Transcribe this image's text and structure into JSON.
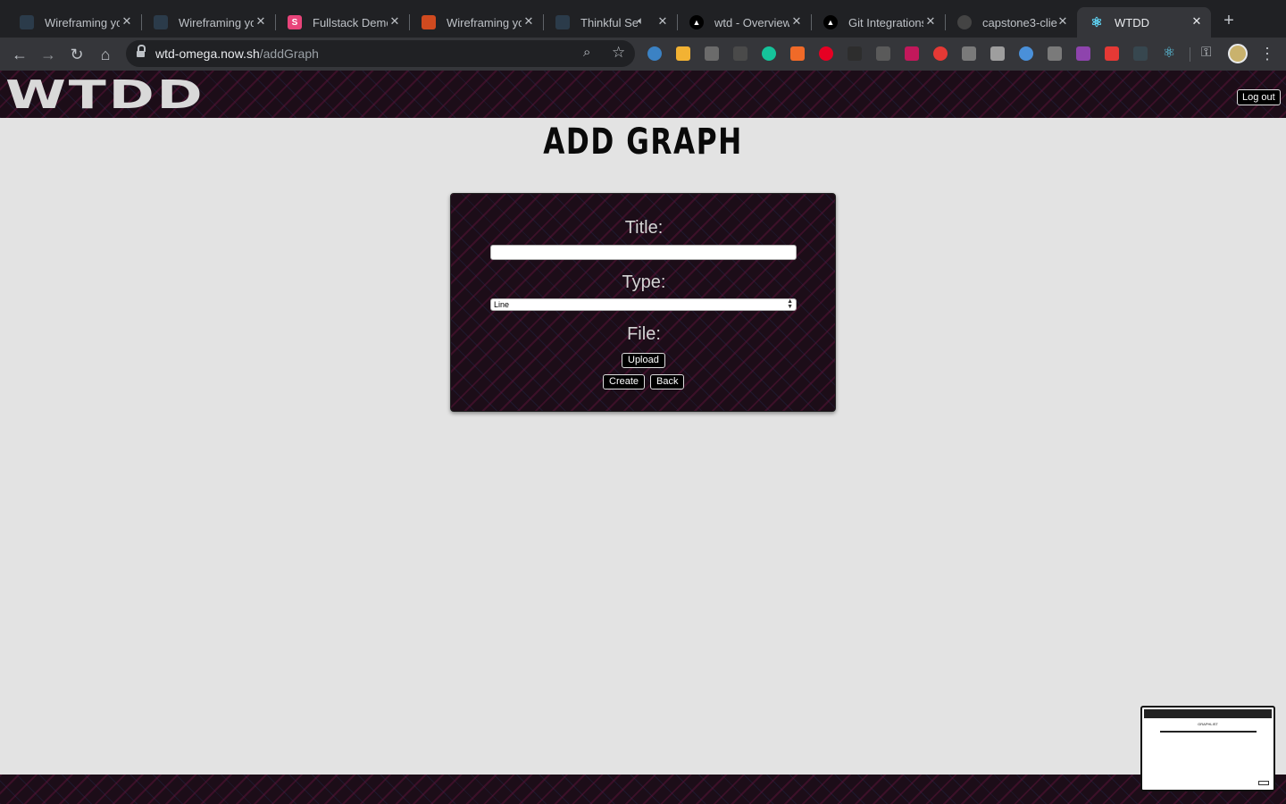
{
  "browser": {
    "tabs": [
      {
        "title": "Wireframing yo",
        "favicon": "wireframe-icon",
        "color": "#2b3b4a"
      },
      {
        "title": "Wireframing yo",
        "favicon": "wireframe-icon",
        "color": "#2b3b4a"
      },
      {
        "title": "Fullstack Demo",
        "favicon": "s-icon",
        "color": "#e8447a",
        "letter": "S"
      },
      {
        "title": "Wireframing yo",
        "favicon": "flag-icon",
        "color": "#d04a1f"
      },
      {
        "title": "Thinkful Se",
        "favicon": "thinkful-icon",
        "color": "#2b3b4a"
      },
      {
        "title": "wtd - Overview",
        "favicon": "vercel-icon",
        "color": "#ffffff"
      },
      {
        "title": "Git Integrations",
        "favicon": "vercel-icon",
        "color": "#ffffff"
      },
      {
        "title": "capstone3-clie",
        "favicon": "github-icon",
        "color": "#444444"
      },
      {
        "title": "WTDD",
        "favicon": "react-icon",
        "color": "#61dafb"
      }
    ],
    "url_host": "wtd-omega.now.sh",
    "url_path": "/addGraph"
  },
  "header": {
    "logo": "WTDD",
    "logout_label": "Log out"
  },
  "page": {
    "title": "ADD GRAPH"
  },
  "form": {
    "title_label": "Title:",
    "title_value": "",
    "type_label": "Type:",
    "type_selected": "Line",
    "file_label": "File:",
    "upload_label": "Upload",
    "create_label": "Create",
    "back_label": "Back"
  },
  "thumbnail": {
    "text": "GRAPHLIST"
  },
  "colors": {
    "page_bg": "#e3e3e3",
    "pattern_bg": "#1c0d18",
    "tabbar_bg": "#202124",
    "toolbar_bg": "#35363a"
  }
}
